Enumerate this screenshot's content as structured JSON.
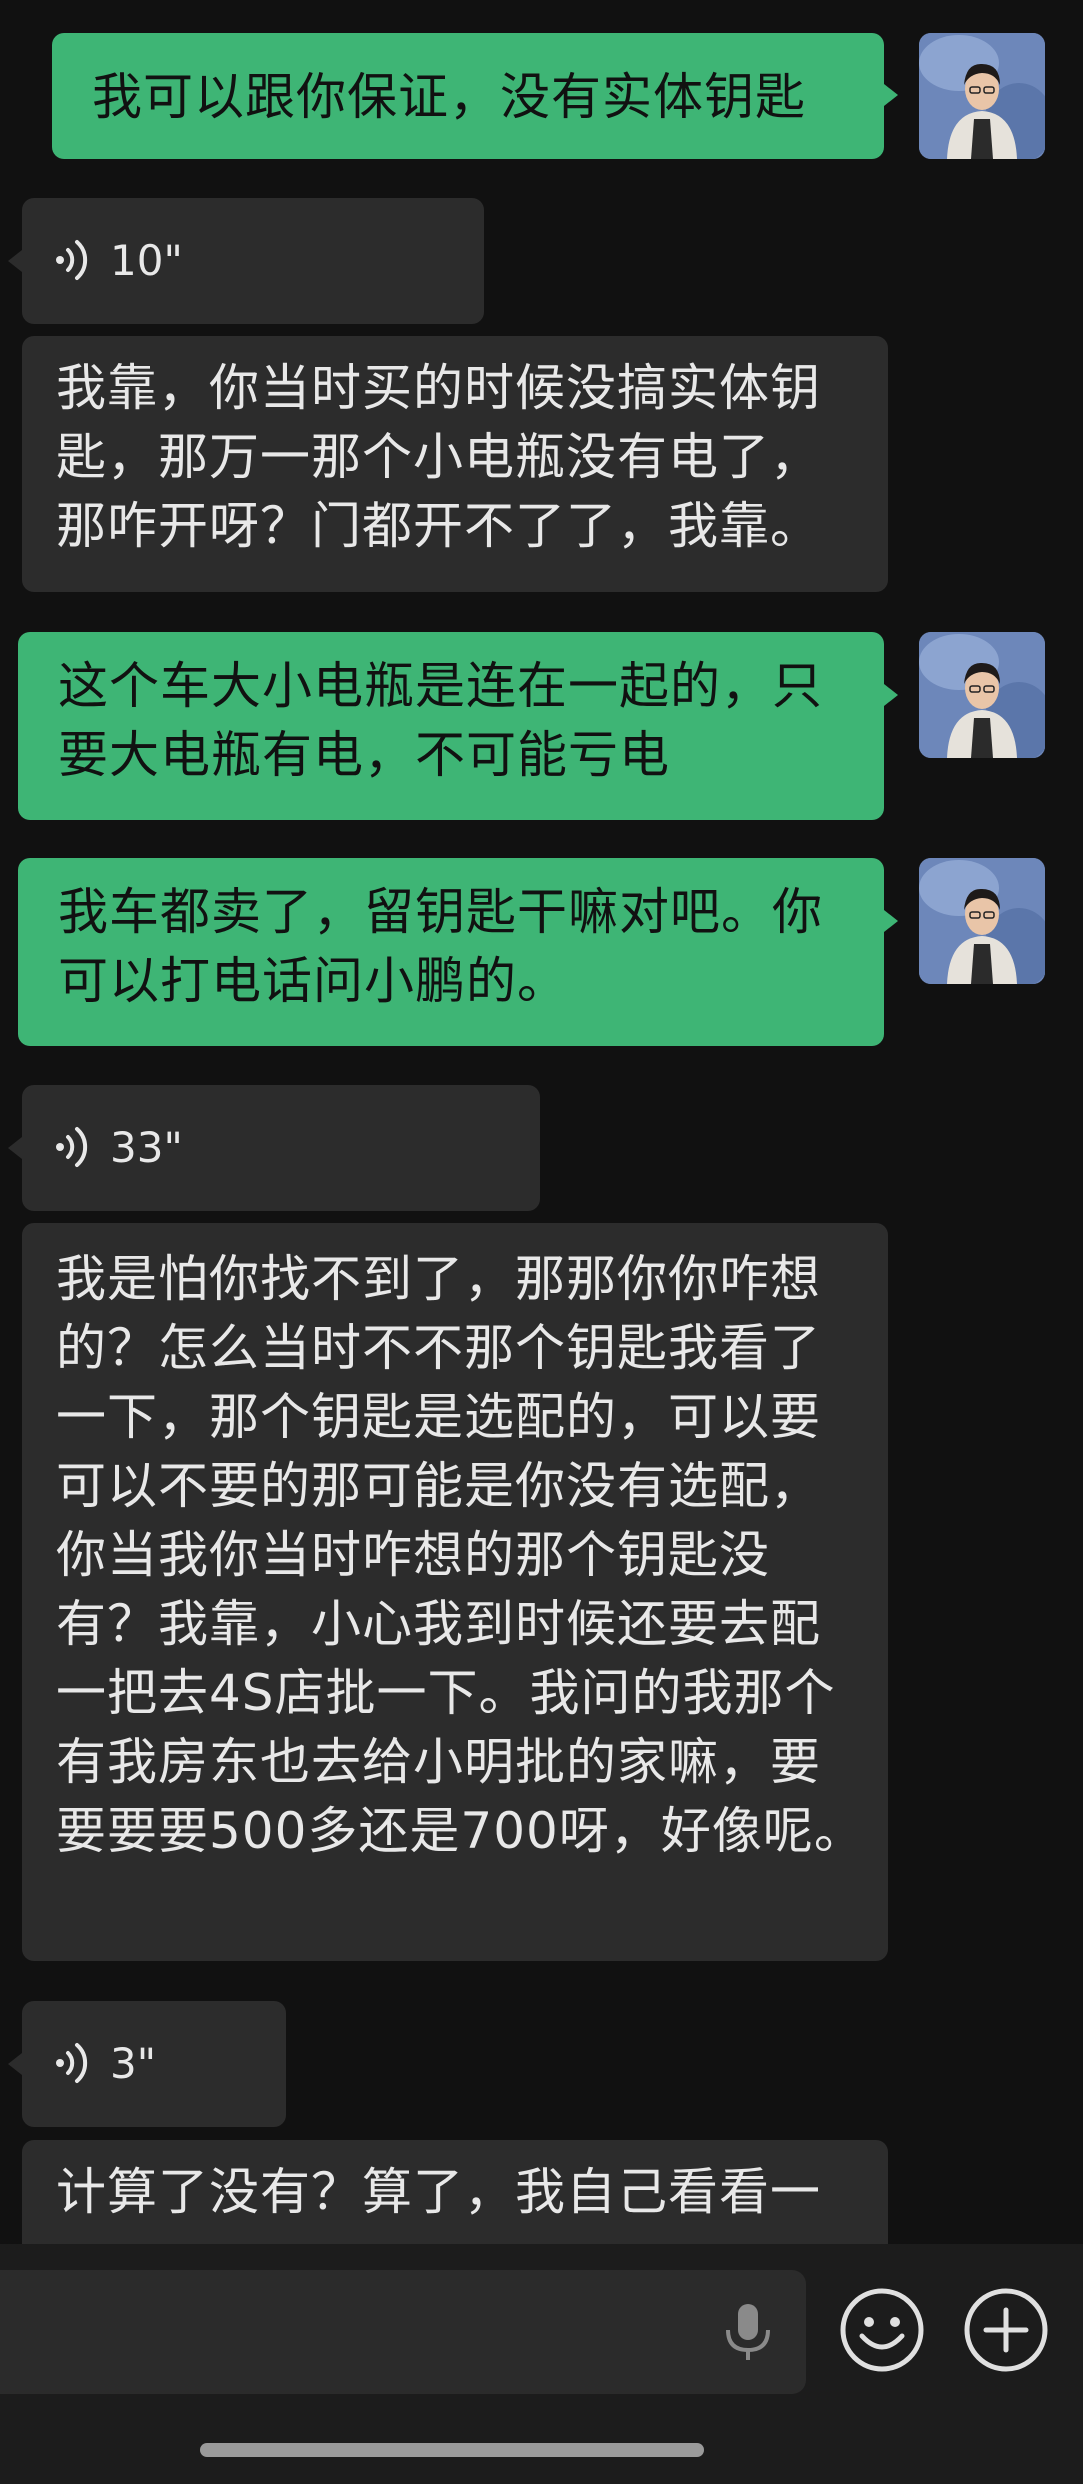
{
  "messages": [
    {
      "type": "text",
      "side": "out",
      "text": "我可以跟你保证，没有实体钥匙"
    },
    {
      "type": "voice",
      "side": "in",
      "duration": "10\""
    },
    {
      "type": "text",
      "side": "in",
      "text": "我靠，你当时买的时候没搞实体钥匙，那万一那个小电瓶没有电了，那咋开呀？门都开不了了，我靠。"
    },
    {
      "type": "text",
      "side": "out",
      "text": "这个车大小电瓶是连在一起的，只要大电瓶有电，不可能亏电"
    },
    {
      "type": "text",
      "side": "out",
      "text": "我车都卖了，留钥匙干嘛对吧。你可以打电话问小鹏的。"
    },
    {
      "type": "voice",
      "side": "in",
      "duration": "33\""
    },
    {
      "type": "text",
      "side": "in",
      "text": "我是怕你找不到了，那那你你咋想的？怎么当时不不那个钥匙我看了一下，那个钥匙是选配的，可以要可以不要的那可能是你没有选配，你当我你当时咋想的那个钥匙没有？我靠，小心我到时候还要去配一把去4S店批一下。我问的我那个有我房东也去给小明批的家嘛，要要要要500多还是700呀，好像呢。"
    },
    {
      "type": "voice",
      "side": "in",
      "duration": "3\""
    },
    {
      "type": "text",
      "side": "in",
      "text": "计算了没有？算了，我自己看看一"
    }
  ],
  "icons": {
    "voice": "voice-wave-icon",
    "mic": "microphone-icon",
    "emoji": "emoji-smile-icon",
    "more": "plus-circle-icon"
  },
  "colors": {
    "background": "#111111",
    "outgoing_bubble": "#3eb575",
    "incoming_bubble": "#2c2c2c"
  }
}
